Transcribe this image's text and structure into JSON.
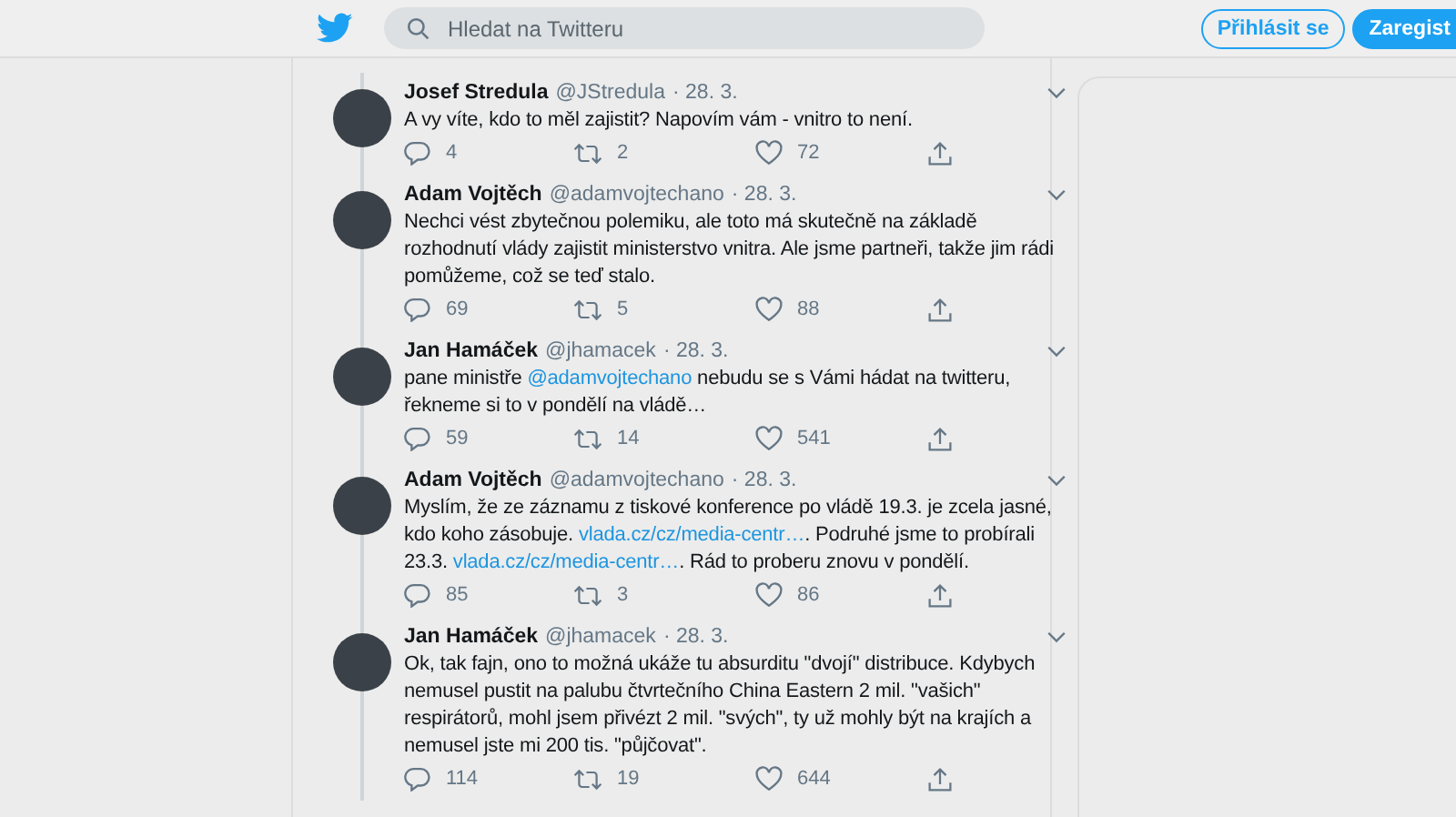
{
  "header": {
    "search": {
      "placeholder": "Hledat na Twitteru"
    },
    "buttons": [
      {
        "label": "Přihlásit se",
        "kind": "outline"
      },
      {
        "label": "Zaregist",
        "kind": "filled"
      }
    ]
  },
  "tweets": [
    {
      "name": "Josef Stredula",
      "handle": "@JStredula",
      "date": "· 28. 3.",
      "body": [
        {
          "kind": "text",
          "text": "A vy víte, kdo to měl zajistit? Napovím vám - vnitro to není."
        }
      ],
      "replies": "4",
      "retweets": "2",
      "likes": "72"
    },
    {
      "name": "Adam Vojtěch",
      "handle": "@adamvojtechano",
      "date": "· 28. 3.",
      "body": [
        {
          "kind": "text",
          "text": "Nechci vést zbytečnou polemiku, ale toto má skutečně na základě rozhodnutí vlády zajistit ministerstvo vnitra. Ale jsme partneři, takže jim rádi pomůžeme, což se teď stalo."
        }
      ],
      "replies": "69",
      "retweets": "5",
      "likes": "88"
    },
    {
      "name": "Jan Hamáček",
      "handle": "@jhamacek",
      "date": "· 28. 3.",
      "body": [
        {
          "kind": "text",
          "text": "pane ministře "
        },
        {
          "kind": "link",
          "text": "@adamvojtechano"
        },
        {
          "kind": "text",
          "text": " nebudu se s Vámi hádat na twitteru, řekneme si to v pondělí na vládě…"
        }
      ],
      "replies": "59",
      "retweets": "14",
      "likes": "541"
    },
    {
      "name": "Adam Vojtěch",
      "handle": "@adamvojtechano",
      "date": "· 28. 3.",
      "body": [
        {
          "kind": "text",
          "text": "Myslím, že ze záznamu z tiskové konference po vládě 19.3. je zcela jasné, kdo koho zásobuje. "
        },
        {
          "kind": "link",
          "text": "vlada.cz/cz/media-centr…"
        },
        {
          "kind": "text",
          "text": ". Podruhé jsme to probírali 23.3. "
        },
        {
          "kind": "link",
          "text": "vlada.cz/cz/media-centr…"
        },
        {
          "kind": "text",
          "text": ". Rád to proberu znovu v pondělí."
        }
      ],
      "replies": "85",
      "retweets": "3",
      "likes": "86"
    },
    {
      "name": "Jan Hamáček",
      "handle": "@jhamacek",
      "date": "· 28. 3.",
      "body": [
        {
          "kind": "text",
          "text": "Ok, tak fajn, ono to možná ukáže tu absurditu \"dvojí\" distribuce. Kdybych nemusel pustit na palubu čtvrtečního China Eastern 2 mil. \"vašich\" respirátorů, mohl jsem přivézt 2 mil. \"svých\", ty už mohly být na krajích a nemusel jste mi 200 tis. \"půjčovat\"."
        }
      ],
      "replies": "114",
      "retweets": "19",
      "likes": "644"
    }
  ]
}
